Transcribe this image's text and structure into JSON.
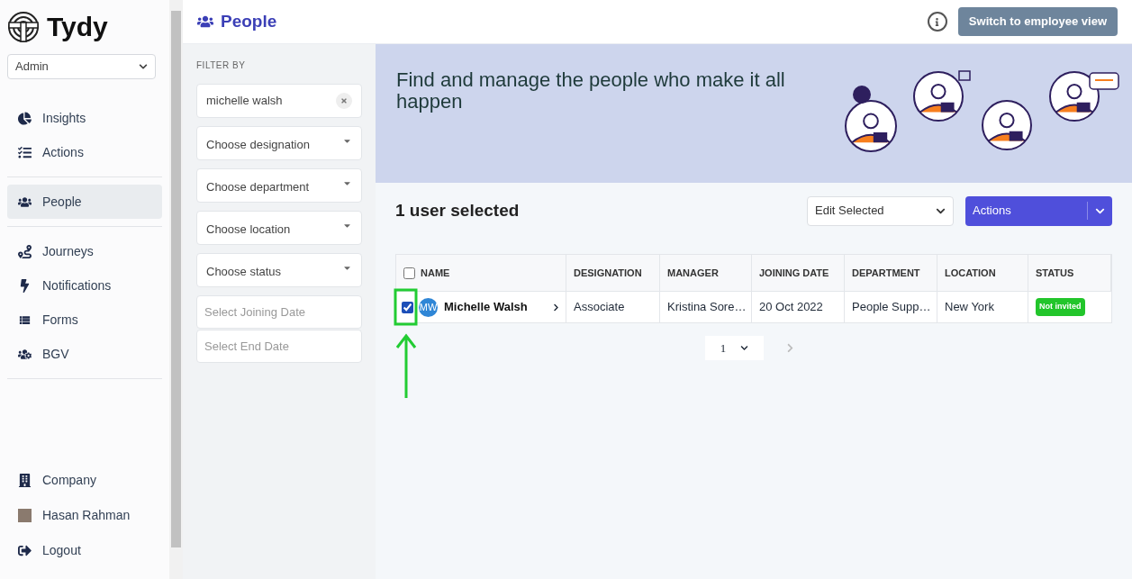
{
  "brand": {
    "name": "Tydy"
  },
  "role_select": {
    "value": "Admin"
  },
  "sidebar": {
    "sections": [
      [
        {
          "label": "Insights",
          "selected": false
        },
        {
          "label": "Actions",
          "selected": false
        }
      ],
      [
        {
          "label": "People",
          "selected": true
        }
      ],
      [
        {
          "label": "Journeys",
          "selected": false
        },
        {
          "label": "Notifications",
          "selected": false
        },
        {
          "label": "Forms",
          "selected": false
        },
        {
          "label": "BGV",
          "selected": false
        }
      ]
    ],
    "bottom": [
      {
        "label": "Company",
        "kind": "link"
      },
      {
        "label": "Hasan Rahman",
        "kind": "user"
      },
      {
        "label": "Logout",
        "kind": "link"
      }
    ]
  },
  "header": {
    "title": "People",
    "button": "Switch to employee view"
  },
  "filters": {
    "heading": "FILTER BY",
    "search": {
      "value": "michelle walsh"
    },
    "selects": [
      {
        "placeholder": "Choose designation"
      },
      {
        "placeholder": "Choose department"
      },
      {
        "placeholder": "Choose location"
      },
      {
        "placeholder": "Choose status"
      }
    ],
    "dates": [
      {
        "placeholder": "Select Joining Date"
      },
      {
        "placeholder": "Select End Date"
      }
    ]
  },
  "banner": {
    "text": "Find and manage the people who make it all happen"
  },
  "selection": {
    "count_text": "1 user selected",
    "edit_select": "Edit Selected",
    "actions_button": "Actions"
  },
  "table": {
    "select_all_checked": false,
    "columns": [
      "NAME",
      "DESIGNATION",
      "MANAGER",
      "JOINING DATE",
      "DEPARTMENT",
      "LOCATION",
      "STATUS"
    ],
    "rows": [
      {
        "checked": true,
        "initials": "MW",
        "name": "Michelle Walsh",
        "designation": "Associate",
        "manager": "Kristina Sore…",
        "joining_date": "20 Oct 2022",
        "department": "People Supp…",
        "location": "New York",
        "status": "Not invited",
        "color": "#22c52b"
      }
    ]
  },
  "pagination": {
    "page": "1"
  },
  "annotation": {
    "shown": true
  }
}
